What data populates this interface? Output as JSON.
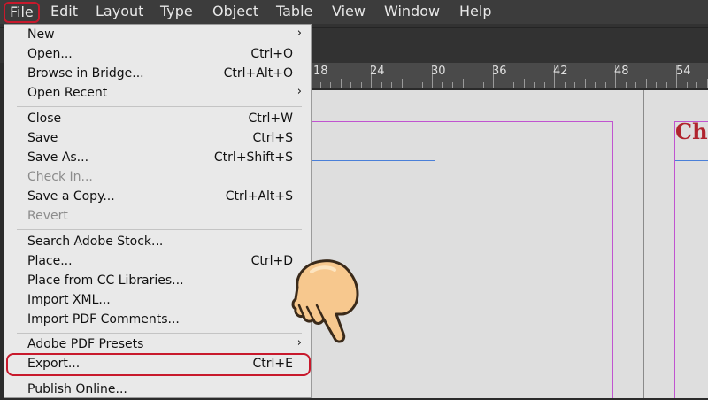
{
  "menubar": {
    "items": [
      "File",
      "Edit",
      "Layout",
      "Type",
      "Object",
      "Table",
      "View",
      "Window",
      "Help"
    ]
  },
  "ruler": {
    "labels": [
      "18",
      "24",
      "30",
      "36",
      "42",
      "48",
      "54"
    ]
  },
  "canvas": {
    "heading_text": "Ch"
  },
  "file_menu": {
    "new": "New",
    "open": "Open...",
    "open_sc": "Ctrl+O",
    "browse": "Browse in Bridge...",
    "browse_sc": "Ctrl+Alt+O",
    "open_recent": "Open Recent",
    "close": "Close",
    "close_sc": "Ctrl+W",
    "save": "Save",
    "save_sc": "Ctrl+S",
    "save_as": "Save As...",
    "save_as_sc": "Ctrl+Shift+S",
    "check_in": "Check In...",
    "save_copy": "Save a Copy...",
    "save_copy_sc": "Ctrl+Alt+S",
    "revert": "Revert",
    "search_stock": "Search Adobe Stock...",
    "place": "Place...",
    "place_sc": "Ctrl+D",
    "place_cc": "Place from CC Libraries...",
    "import_xml": "Import XML...",
    "import_pdf_comments": "Import PDF Comments...",
    "pdf_presets": "Adobe PDF Presets",
    "export": "Export...",
    "export_sc": "Ctrl+E",
    "publish_online": "Publish Online..."
  },
  "colors": {
    "highlight": "#c8192c",
    "guide_magenta": "#c054d0",
    "frame_blue": "#4a7fd8",
    "heading": "#b0242e"
  }
}
